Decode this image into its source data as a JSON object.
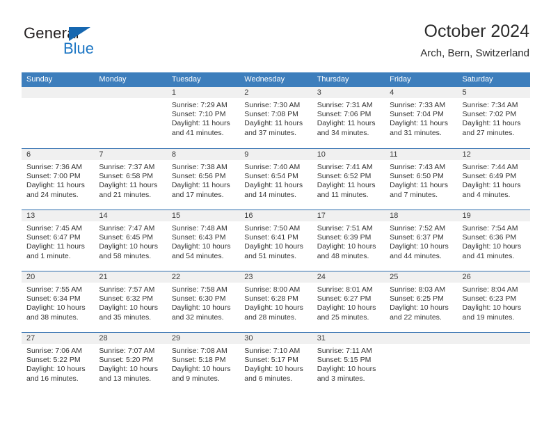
{
  "logo": {
    "word_top": "General",
    "word_bottom": "Blue",
    "triangle_icon": "triangle-icon",
    "color_dark": "#231f20",
    "color_blue": "#1c76c4"
  },
  "header": {
    "title": "October 2024",
    "subtitle": "Arch, Bern, Switzerland"
  },
  "colors": {
    "header_blue": "#3d7ebc",
    "divider_blue": "#2a6aad",
    "daynum_band": "#f0f0f0"
  },
  "calendar": {
    "weekday_labels": [
      "Sunday",
      "Monday",
      "Tuesday",
      "Wednesday",
      "Thursday",
      "Friday",
      "Saturday"
    ],
    "weeks": [
      [
        {
          "day": "",
          "lines": []
        },
        {
          "day": "",
          "lines": []
        },
        {
          "day": "1",
          "lines": [
            "Sunrise: 7:29 AM",
            "Sunset: 7:10 PM",
            "Daylight: 11 hours",
            "and 41 minutes."
          ]
        },
        {
          "day": "2",
          "lines": [
            "Sunrise: 7:30 AM",
            "Sunset: 7:08 PM",
            "Daylight: 11 hours",
            "and 37 minutes."
          ]
        },
        {
          "day": "3",
          "lines": [
            "Sunrise: 7:31 AM",
            "Sunset: 7:06 PM",
            "Daylight: 11 hours",
            "and 34 minutes."
          ]
        },
        {
          "day": "4",
          "lines": [
            "Sunrise: 7:33 AM",
            "Sunset: 7:04 PM",
            "Daylight: 11 hours",
            "and 31 minutes."
          ]
        },
        {
          "day": "5",
          "lines": [
            "Sunrise: 7:34 AM",
            "Sunset: 7:02 PM",
            "Daylight: 11 hours",
            "and 27 minutes."
          ]
        }
      ],
      [
        {
          "day": "6",
          "lines": [
            "Sunrise: 7:36 AM",
            "Sunset: 7:00 PM",
            "Daylight: 11 hours",
            "and 24 minutes."
          ]
        },
        {
          "day": "7",
          "lines": [
            "Sunrise: 7:37 AM",
            "Sunset: 6:58 PM",
            "Daylight: 11 hours",
            "and 21 minutes."
          ]
        },
        {
          "day": "8",
          "lines": [
            "Sunrise: 7:38 AM",
            "Sunset: 6:56 PM",
            "Daylight: 11 hours",
            "and 17 minutes."
          ]
        },
        {
          "day": "9",
          "lines": [
            "Sunrise: 7:40 AM",
            "Sunset: 6:54 PM",
            "Daylight: 11 hours",
            "and 14 minutes."
          ]
        },
        {
          "day": "10",
          "lines": [
            "Sunrise: 7:41 AM",
            "Sunset: 6:52 PM",
            "Daylight: 11 hours",
            "and 11 minutes."
          ]
        },
        {
          "day": "11",
          "lines": [
            "Sunrise: 7:43 AM",
            "Sunset: 6:50 PM",
            "Daylight: 11 hours",
            "and 7 minutes."
          ]
        },
        {
          "day": "12",
          "lines": [
            "Sunrise: 7:44 AM",
            "Sunset: 6:49 PM",
            "Daylight: 11 hours",
            "and 4 minutes."
          ]
        }
      ],
      [
        {
          "day": "13",
          "lines": [
            "Sunrise: 7:45 AM",
            "Sunset: 6:47 PM",
            "Daylight: 11 hours",
            "and 1 minute."
          ]
        },
        {
          "day": "14",
          "lines": [
            "Sunrise: 7:47 AM",
            "Sunset: 6:45 PM",
            "Daylight: 10 hours",
            "and 58 minutes."
          ]
        },
        {
          "day": "15",
          "lines": [
            "Sunrise: 7:48 AM",
            "Sunset: 6:43 PM",
            "Daylight: 10 hours",
            "and 54 minutes."
          ]
        },
        {
          "day": "16",
          "lines": [
            "Sunrise: 7:50 AM",
            "Sunset: 6:41 PM",
            "Daylight: 10 hours",
            "and 51 minutes."
          ]
        },
        {
          "day": "17",
          "lines": [
            "Sunrise: 7:51 AM",
            "Sunset: 6:39 PM",
            "Daylight: 10 hours",
            "and 48 minutes."
          ]
        },
        {
          "day": "18",
          "lines": [
            "Sunrise: 7:52 AM",
            "Sunset: 6:37 PM",
            "Daylight: 10 hours",
            "and 44 minutes."
          ]
        },
        {
          "day": "19",
          "lines": [
            "Sunrise: 7:54 AM",
            "Sunset: 6:36 PM",
            "Daylight: 10 hours",
            "and 41 minutes."
          ]
        }
      ],
      [
        {
          "day": "20",
          "lines": [
            "Sunrise: 7:55 AM",
            "Sunset: 6:34 PM",
            "Daylight: 10 hours",
            "and 38 minutes."
          ]
        },
        {
          "day": "21",
          "lines": [
            "Sunrise: 7:57 AM",
            "Sunset: 6:32 PM",
            "Daylight: 10 hours",
            "and 35 minutes."
          ]
        },
        {
          "day": "22",
          "lines": [
            "Sunrise: 7:58 AM",
            "Sunset: 6:30 PM",
            "Daylight: 10 hours",
            "and 32 minutes."
          ]
        },
        {
          "day": "23",
          "lines": [
            "Sunrise: 8:00 AM",
            "Sunset: 6:28 PM",
            "Daylight: 10 hours",
            "and 28 minutes."
          ]
        },
        {
          "day": "24",
          "lines": [
            "Sunrise: 8:01 AM",
            "Sunset: 6:27 PM",
            "Daylight: 10 hours",
            "and 25 minutes."
          ]
        },
        {
          "day": "25",
          "lines": [
            "Sunrise: 8:03 AM",
            "Sunset: 6:25 PM",
            "Daylight: 10 hours",
            "and 22 minutes."
          ]
        },
        {
          "day": "26",
          "lines": [
            "Sunrise: 8:04 AM",
            "Sunset: 6:23 PM",
            "Daylight: 10 hours",
            "and 19 minutes."
          ]
        }
      ],
      [
        {
          "day": "27",
          "lines": [
            "Sunrise: 7:06 AM",
            "Sunset: 5:22 PM",
            "Daylight: 10 hours",
            "and 16 minutes."
          ]
        },
        {
          "day": "28",
          "lines": [
            "Sunrise: 7:07 AM",
            "Sunset: 5:20 PM",
            "Daylight: 10 hours",
            "and 13 minutes."
          ]
        },
        {
          "day": "29",
          "lines": [
            "Sunrise: 7:08 AM",
            "Sunset: 5:18 PM",
            "Daylight: 10 hours",
            "and 9 minutes."
          ]
        },
        {
          "day": "30",
          "lines": [
            "Sunrise: 7:10 AM",
            "Sunset: 5:17 PM",
            "Daylight: 10 hours",
            "and 6 minutes."
          ]
        },
        {
          "day": "31",
          "lines": [
            "Sunrise: 7:11 AM",
            "Sunset: 5:15 PM",
            "Daylight: 10 hours",
            "and 3 minutes."
          ]
        },
        {
          "day": "",
          "lines": []
        },
        {
          "day": "",
          "lines": []
        }
      ]
    ]
  }
}
